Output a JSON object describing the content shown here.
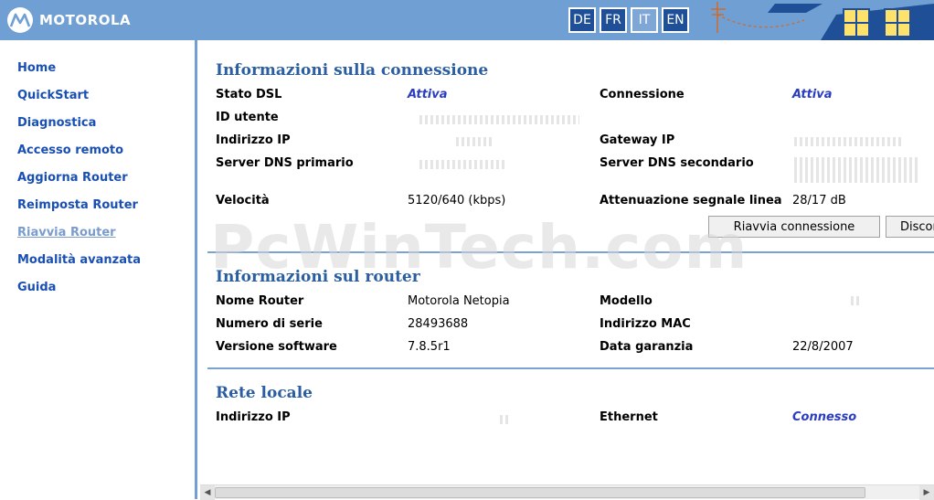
{
  "header": {
    "brand": "MOTOROLA",
    "languages": [
      "DE",
      "FR",
      "IT",
      "EN"
    ],
    "active_language": "IT"
  },
  "sidebar": {
    "items": [
      {
        "label": "Home"
      },
      {
        "label": "QuickStart"
      },
      {
        "label": "Diagnostica"
      },
      {
        "label": "Accesso remoto"
      },
      {
        "label": "Aggiorna Router"
      },
      {
        "label": "Reimposta Router"
      },
      {
        "label": "Riavvia Router"
      },
      {
        "label": "Modalità avanzata"
      },
      {
        "label": "Guida"
      }
    ],
    "current_item": "Riavvia Router"
  },
  "connection": {
    "title": "Informazioni sulla connessione",
    "dsl_status_label": "Stato DSL",
    "dsl_status_value": "Attiva",
    "connection_label": "Connessione",
    "connection_value": "Attiva",
    "user_id_label": "ID utente",
    "ip_label": "Indirizzo IP",
    "gateway_label": "Gateway IP",
    "dns_primary_label": "Server DNS primario",
    "dns_secondary_label": "Server DNS secondario",
    "speed_label": "Velocità",
    "speed_value": "5120/640 (kbps)",
    "attenuation_label": "Attenuazione segnale linea",
    "attenuation_value": "28/17 dB",
    "restart_button": "Riavvia connessione",
    "disconnect_button": "Disconnetti"
  },
  "router": {
    "title": "Informazioni sul router",
    "name_label": "Nome Router",
    "name_value": "Motorola Netopia",
    "model_label": "Modello",
    "serial_label": "Numero di serie",
    "serial_value": "28493688",
    "mac_label": "Indirizzo MAC",
    "software_label": "Versione software",
    "software_value": "7.8.5r1",
    "warranty_label": "Data garanzia",
    "warranty_value": "22/8/2007"
  },
  "lan": {
    "title": "Rete locale",
    "ip_label": "Indirizzo IP",
    "ethernet_label": "Ethernet",
    "ethernet_value": "Connesso"
  },
  "watermark": "PcWinTech.com",
  "colors": {
    "header": "#6f9fd3",
    "nav_link": "#1a4fb3",
    "section_title": "#2a5ea0",
    "status": "#2a3cc0"
  }
}
